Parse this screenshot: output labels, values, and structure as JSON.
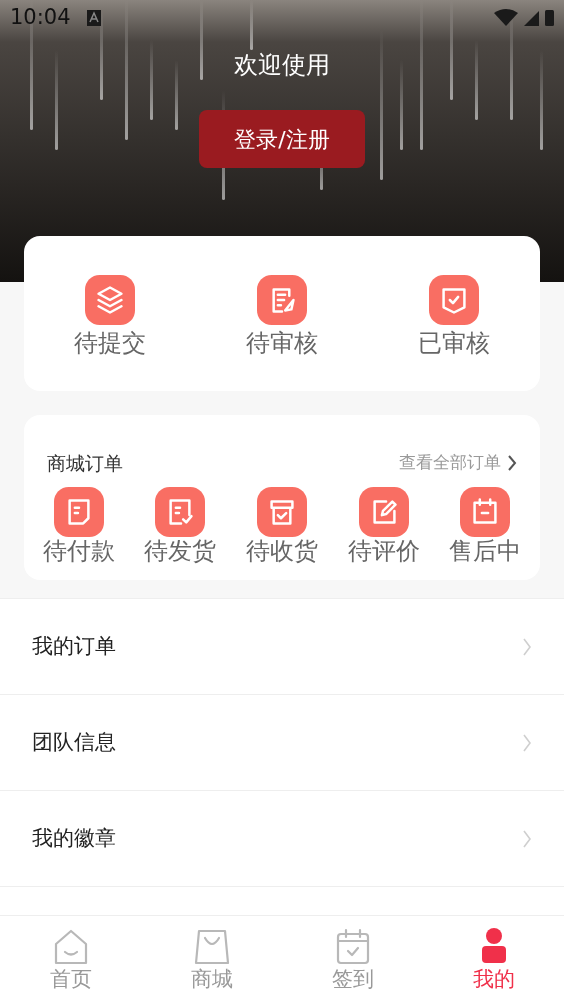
{
  "status_bar": {
    "time": "10:04"
  },
  "header": {
    "title": "欢迎使用",
    "login_button": "登录/注册"
  },
  "review_card": {
    "items": [
      {
        "kind": "layers",
        "label": "待提交"
      },
      {
        "kind": "doc-pen",
        "label": "待审核"
      },
      {
        "kind": "badge-check",
        "label": "已审核"
      }
    ]
  },
  "order_card": {
    "title": "商城订单",
    "view_all": "查看全部订单",
    "items": [
      {
        "kind": "note",
        "label": "待付款"
      },
      {
        "kind": "note-check",
        "label": "待发货"
      },
      {
        "kind": "box-check",
        "label": "待收货"
      },
      {
        "kind": "edit",
        "label": "待评价"
      },
      {
        "kind": "calendar",
        "label": "售后中"
      }
    ]
  },
  "menu": [
    {
      "label": "我的订单"
    },
    {
      "label": "团队信息"
    },
    {
      "label": "我的徽章"
    }
  ],
  "tab_bar": [
    {
      "kind": "home",
      "label": "首页",
      "selected": false
    },
    {
      "kind": "bag",
      "label": "商城",
      "selected": false
    },
    {
      "kind": "calendar",
      "label": "签到",
      "selected": false
    },
    {
      "kind": "person",
      "label": "我的",
      "selected": true
    }
  ]
}
